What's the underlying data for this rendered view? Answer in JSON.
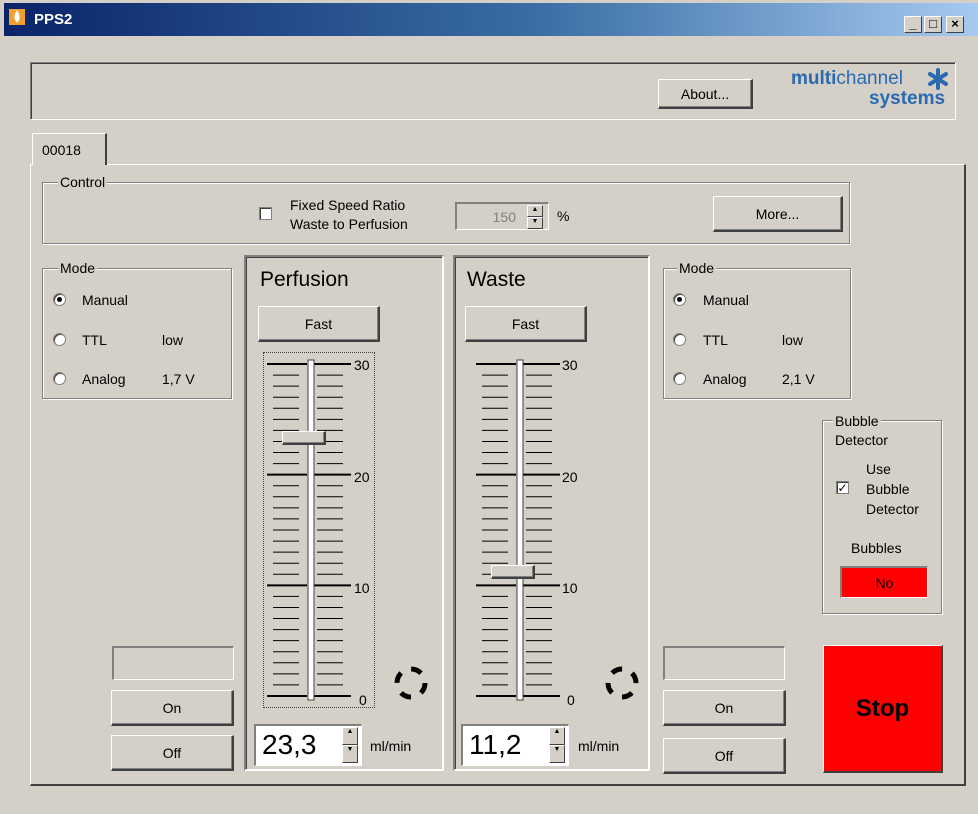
{
  "window": {
    "title": "PPS2"
  },
  "header": {
    "about_label": "About...",
    "logo_line1_bold": "multi",
    "logo_line1_rest": "channel",
    "logo_line2": "systems"
  },
  "tabs": [
    {
      "label": "00018"
    }
  ],
  "control": {
    "legend": "Control",
    "fixed_ratio_line1": "Fixed Speed Ratio",
    "fixed_ratio_line2": "Waste to Perfusion",
    "fixed_ratio_checked": false,
    "ratio_value": "150",
    "ratio_unit": "%",
    "more_label": "More..."
  },
  "left_mode": {
    "legend": "Mode",
    "manual": "Manual",
    "ttl": "TTL",
    "ttl_state": "low",
    "analog": "Analog",
    "analog_value": "1,7 V",
    "selected": "Manual"
  },
  "right_mode": {
    "legend": "Mode",
    "manual": "Manual",
    "ttl": "TTL",
    "ttl_state": "low",
    "analog": "Analog",
    "analog_value": "2,1 V",
    "selected": "Manual"
  },
  "perfusion": {
    "title": "Perfusion",
    "fast_label": "Fast",
    "tick_max": "30",
    "tick_20": "20",
    "tick_10": "10",
    "tick_min": "0",
    "value": "23,3",
    "unit": "ml/min",
    "slider_value": 23.3
  },
  "waste": {
    "title": "Waste",
    "fast_label": "Fast",
    "tick_max": "30",
    "tick_20": "20",
    "tick_10": "10",
    "tick_min": "0",
    "value": "11,2",
    "unit": "ml/min",
    "slider_value": 11.2
  },
  "left_controls": {
    "on_label": "On",
    "off_label": "Off"
  },
  "right_controls": {
    "on_label": "On",
    "off_label": "Off"
  },
  "bubble": {
    "legend_line1": "Bubble",
    "legend_line2": "Detector",
    "use_line1": "Use",
    "use_line2": "Bubble",
    "use_line3": "Detector",
    "use_checked": true,
    "bubbles_label": "Bubbles",
    "status": "No",
    "status_color": "#ff0000"
  },
  "stop": {
    "label": "Stop",
    "color": "#ff0000"
  },
  "colors": {
    "face": "#d4d0c8",
    "title_start": "#0a246a"
  }
}
